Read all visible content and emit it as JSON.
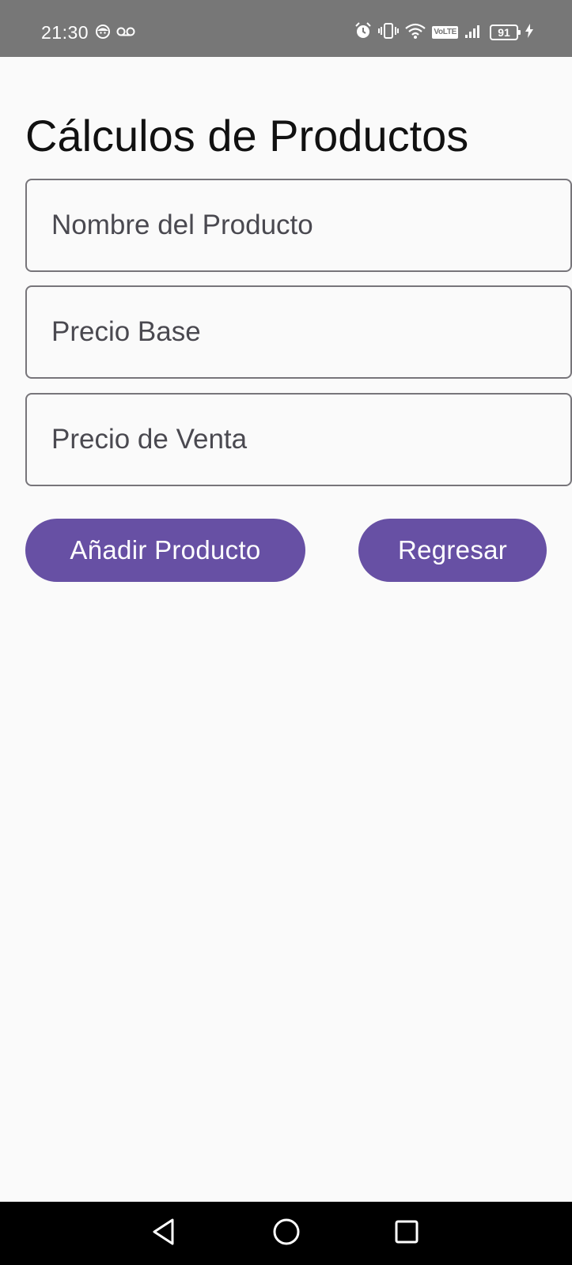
{
  "status_bar": {
    "time": "21:30",
    "volte_label": "VoLTE",
    "battery_level": "91",
    "icons": [
      "face-icon",
      "voicemail-icon",
      "alarm-icon",
      "vibrate-icon",
      "wifi-icon",
      "volte-icon",
      "signal-icon",
      "battery-icon",
      "charging-icon"
    ]
  },
  "page": {
    "title": "Cálculos de Productos"
  },
  "form": {
    "product_name_placeholder": "Nombre del Producto",
    "base_price_placeholder": "Precio Base",
    "sale_price_placeholder": "Precio de Venta"
  },
  "actions": {
    "add_label": "Añadir Producto",
    "back_label": "Regresar"
  },
  "nav_bar": {
    "icons": [
      "back-icon",
      "home-icon",
      "recents-icon"
    ]
  },
  "colors": {
    "status_bar_bg": "#777777",
    "background": "#fafafa",
    "primary": "#6750a4",
    "field_border": "#77757a",
    "nav_bar_bg": "#000000"
  }
}
